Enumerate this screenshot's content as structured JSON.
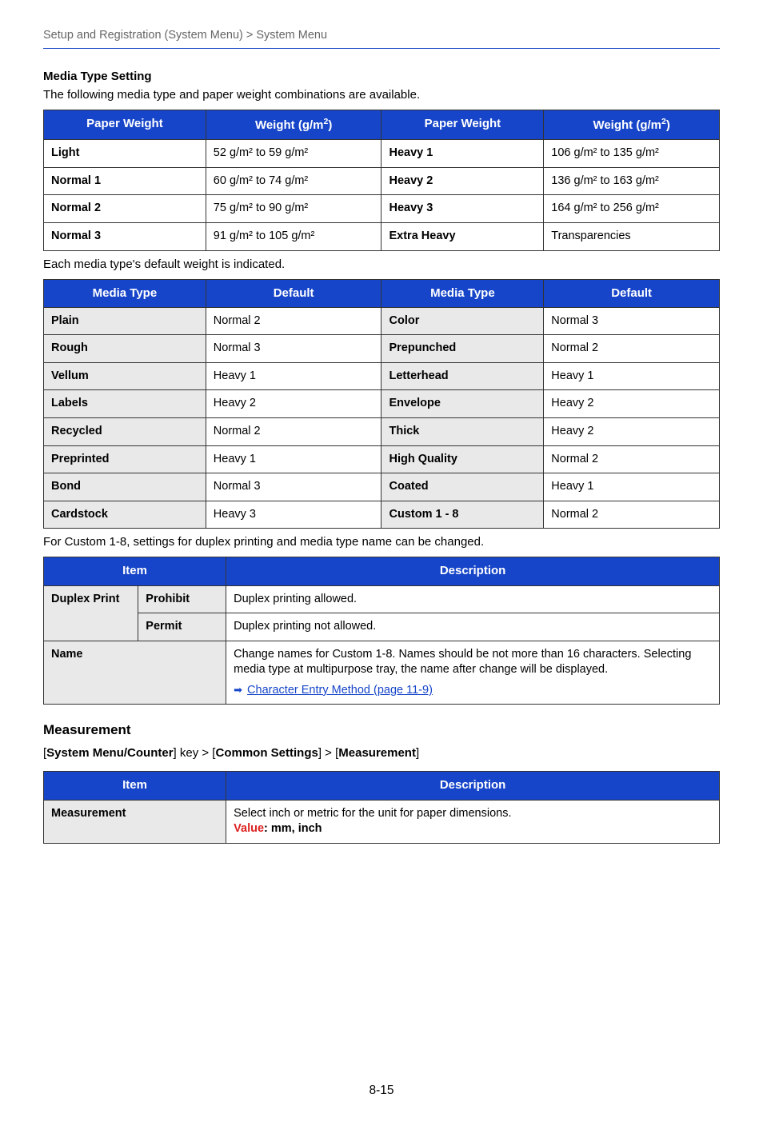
{
  "breadcrumb": "Setup and Registration (System Menu) > System Menu",
  "section1": {
    "heading": "Media Type Setting",
    "intro": "The following media type and paper weight combinations are available.",
    "headers": [
      "Paper Weight",
      "Weight (g/m",
      "Paper Weight",
      "Weight (g/m"
    ],
    "sup": "2",
    "close": ")",
    "rows": [
      [
        "Light",
        "52 g/m² to 59 g/m²",
        "Heavy 1",
        "106 g/m² to 135 g/m²"
      ],
      [
        "Normal 1",
        "60 g/m² to 74 g/m²",
        "Heavy 2",
        "136 g/m² to 163 g/m²"
      ],
      [
        "Normal 2",
        "75 g/m² to 90 g/m²",
        "Heavy 3",
        "164 g/m² to 256 g/m²"
      ],
      [
        "Normal 3",
        "91 g/m² to 105 g/m²",
        "Extra Heavy",
        "Transparencies"
      ]
    ]
  },
  "section2": {
    "intro": "Each media type's default weight is indicated.",
    "headers": [
      "Media Type",
      "Default",
      "Media Type",
      "Default"
    ],
    "rows": [
      [
        "Plain",
        "Normal 2",
        "Color",
        "Normal 3"
      ],
      [
        "Rough",
        "Normal 3",
        "Prepunched",
        "Normal 2"
      ],
      [
        "Vellum",
        "Heavy 1",
        "Letterhead",
        "Heavy 1"
      ],
      [
        "Labels",
        "Heavy 2",
        "Envelope",
        "Heavy 2"
      ],
      [
        "Recycled",
        "Normal 2",
        "Thick",
        "Heavy 2"
      ],
      [
        "Preprinted",
        "Heavy 1",
        "High Quality",
        "Normal 2"
      ],
      [
        "Bond",
        "Normal 3",
        "Coated",
        "Heavy 1"
      ],
      [
        "Cardstock",
        "Heavy 3",
        "Custom 1 - 8",
        "Normal 2"
      ]
    ]
  },
  "section3": {
    "intro": "For Custom 1-8, settings for duplex printing and media type name can be changed.",
    "headers": [
      "Item",
      "Description"
    ],
    "duplex_label": "Duplex Print",
    "prohibit_label": "Prohibit",
    "prohibit_desc": "Duplex printing allowed.",
    "permit_label": "Permit",
    "permit_desc": "Duplex printing not allowed.",
    "name_label": "Name",
    "name_desc": "Change names for Custom 1-8. Names should be not more than 16 characters. Selecting media type at multipurpose tray, the name after change will be displayed.",
    "link": "Character Entry Method (page 11-9)"
  },
  "section4": {
    "heading": "Measurement",
    "path_prefix": "[",
    "path_1": "System Menu/Counter",
    "path_mid1": "] key > [",
    "path_2": "Common Settings",
    "path_mid2": "] > [",
    "path_3": "Measurement",
    "path_suffix": "]",
    "headers": [
      "Item",
      "Description"
    ],
    "item": "Measurement",
    "desc": "Select inch or metric for the unit for paper dimensions.",
    "value_label": "Value",
    "value_sep": ": ",
    "value_value": "mm, inch"
  },
  "pagenum": "8-15"
}
